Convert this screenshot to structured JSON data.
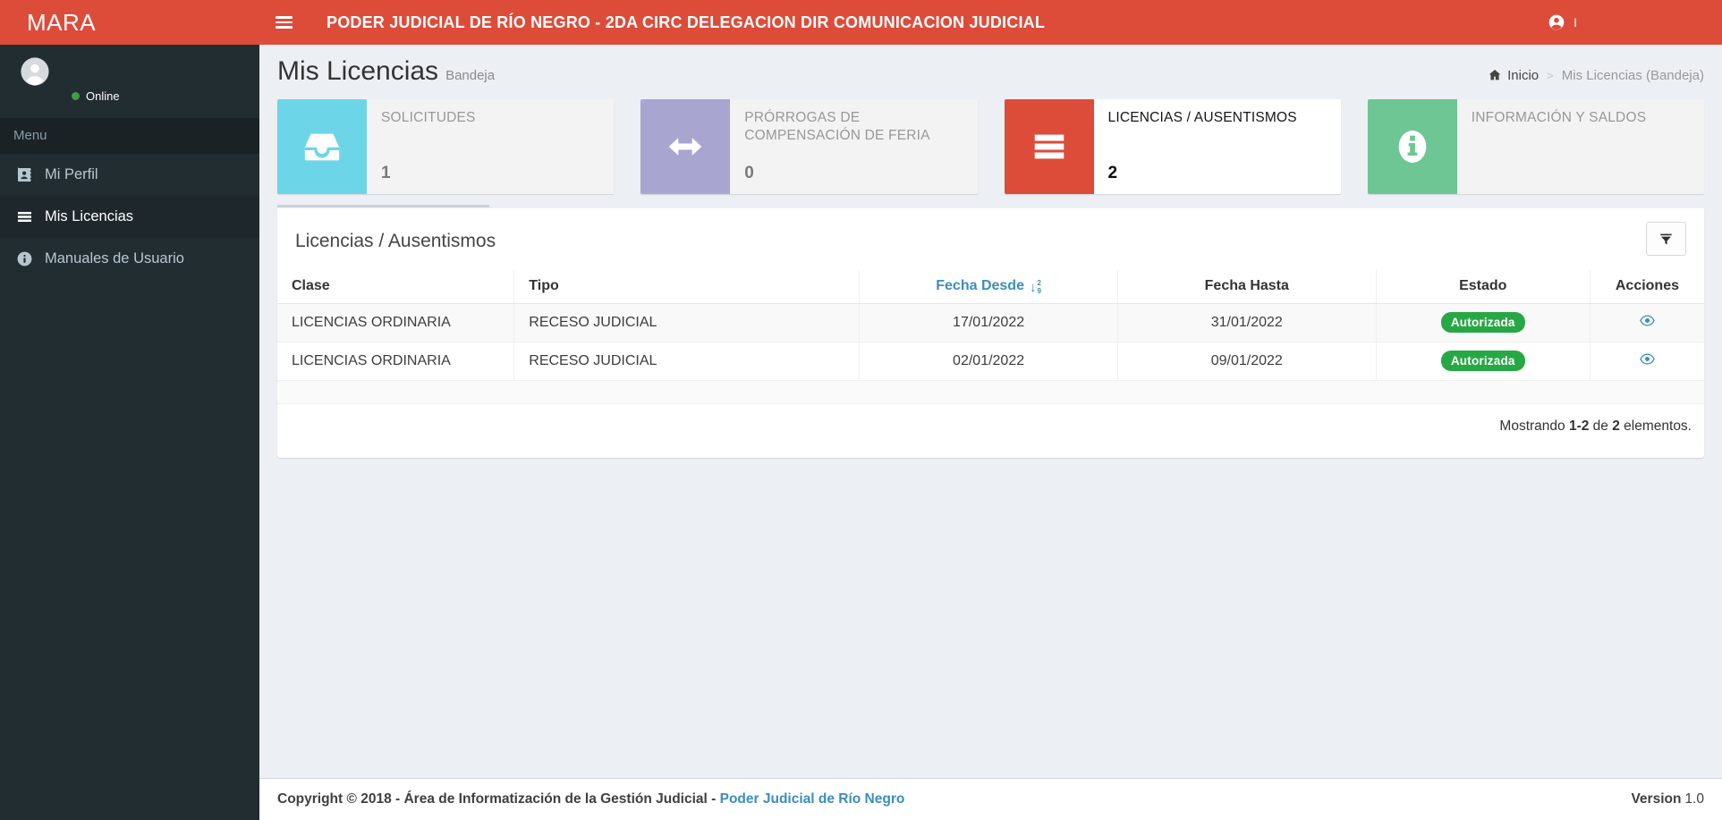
{
  "theme": {
    "accent": "#dd4b39",
    "sidebar_bg": "#222d32",
    "sidebar_text": "#b8c7ce",
    "body_bg": "#ecf0f5",
    "link": "#3c8dbc",
    "badge_green": "#28a745",
    "status_green": "#3f9d49"
  },
  "header": {
    "logo": "MARA",
    "title": "PODER JUDICIAL DE RÍO NEGRO - 2DA CIRC DELEGACION DIR COMUNICACION JUDICIAL",
    "user_label": "I"
  },
  "sidebar": {
    "status": "Online",
    "menu_header": "Menu",
    "items": [
      {
        "label": "Mi Perfil",
        "icon": "id-card-icon",
        "active": false
      },
      {
        "label": "Mis Licencias",
        "icon": "list-icon",
        "active": true
      },
      {
        "label": "Manuales de Usuario",
        "icon": "info-circle-icon",
        "active": false
      }
    ]
  },
  "page": {
    "title": "Mis Licencias",
    "subtitle": "Bandeja",
    "breadcrumb_home": "Inicio",
    "breadcrumb_sep": ">",
    "breadcrumb_current": "Mis Licencias (Bandeja)"
  },
  "info_boxes": [
    {
      "label": "SOLICITUDES",
      "value": "1",
      "color": "#6dd5e8",
      "icon": "inbox-icon"
    },
    {
      "label": "PRÓRROGAS DE COMPENSACIÓN DE FERIA",
      "value": "0",
      "color": "#a9a5d1",
      "icon": "arrows-horizontal-icon"
    },
    {
      "label": "LICENCIAS / AUSENTISMOS",
      "value": "2",
      "color": "#dd4b39",
      "icon": "list-icon"
    },
    {
      "label": "INFORMACIÓN Y SALDOS",
      "value": "",
      "color": "#6ec694",
      "icon": "info-icon"
    }
  ],
  "panel": {
    "title": "Licencias / Ausentismos",
    "filter_icon": "funnel-icon",
    "sort_icon": "sort-numeric-desc-icon",
    "action_icon": "eye-icon",
    "columns": {
      "clase": "Clase",
      "tipo": "Tipo",
      "desde": "Fecha Desde",
      "hasta": "Fecha Hasta",
      "estado": "Estado",
      "acciones": "Acciones"
    },
    "rows": [
      {
        "clase": "LICENCIAS ORDINARIA",
        "tipo": "RECESO JUDICIAL",
        "desde": "17/01/2022",
        "hasta": "31/01/2022",
        "estado": "Autorizada"
      },
      {
        "clase": "LICENCIAS ORDINARIA",
        "tipo": "RECESO JUDICIAL",
        "desde": "02/01/2022",
        "hasta": "09/01/2022",
        "estado": "Autorizada"
      }
    ],
    "summary": {
      "word1": "Mostrando",
      "range": "1-2",
      "word2": "de",
      "total": "2",
      "word3": "elementos."
    }
  },
  "footer": {
    "copyright": "Copyright © 2018 - Área de Informatización de la Gestión Judicial -",
    "link": "Poder Judicial de Río Negro",
    "version_label": "Version",
    "version_value": "1.0"
  }
}
